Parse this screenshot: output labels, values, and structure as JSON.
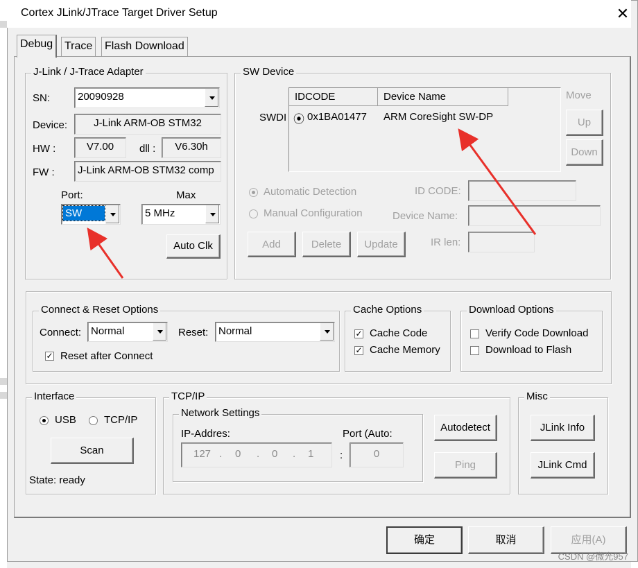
{
  "window": {
    "title": "Cortex JLink/JTrace Target Driver Setup",
    "close_glyph": "✕"
  },
  "tabs": [
    {
      "label": "Debug",
      "active": true
    },
    {
      "label": "Trace",
      "active": false
    },
    {
      "label": "Flash Download",
      "active": false
    }
  ],
  "adapter": {
    "group_label": "J-Link / J-Trace Adapter",
    "sn_label": "SN:",
    "sn_value": "20090928",
    "device_label": "Device:",
    "device_value": "J-Link ARM-OB STM32",
    "hw_label": "HW :",
    "hw_value": "V7.00",
    "dll_label": "dll :",
    "dll_value": "V6.30h",
    "fw_label": "FW :",
    "fw_value": "J-Link ARM-OB STM32 comp",
    "port_label": "Port:",
    "port_value": "SW",
    "max_label": "Max",
    "max_value": "5 MHz",
    "auto_clk_button": "Auto Clk"
  },
  "sw_device": {
    "group_label": "SW Device",
    "swdi_label": "SWDI",
    "columns": [
      "IDCODE",
      "Device Name"
    ],
    "rows": [
      {
        "radio": "⦿",
        "idcode": "0x1BA01477",
        "device_name": "ARM CoreSight SW-DP"
      }
    ],
    "move_label": "Move",
    "up_button": "Up",
    "down_button": "Down",
    "auto_detection_label": "Automatic Detection",
    "manual_config_label": "Manual Configuration",
    "id_code_label": "ID CODE:",
    "device_name_label": "Device Name:",
    "ir_len_label": "IR len:",
    "add_button": "Add",
    "delete_button": "Delete",
    "update_button": "Update"
  },
  "connect_reset": {
    "group_label": "Connect & Reset Options",
    "connect_label": "Connect:",
    "connect_value": "Normal",
    "reset_label": "Reset:",
    "reset_value": "Normal",
    "reset_after_connect_label": "Reset after Connect",
    "reset_after_connect_checked": true
  },
  "cache_options": {
    "group_label": "Cache Options",
    "cache_code_label": "Cache Code",
    "cache_code_checked": true,
    "cache_memory_label": "Cache Memory",
    "cache_memory_checked": true
  },
  "download_options": {
    "group_label": "Download Options",
    "verify_label": "Verify Code Download",
    "verify_checked": false,
    "download_flash_label": "Download to Flash",
    "download_flash_checked": false
  },
  "interface": {
    "group_label": "Interface",
    "usb_label": "USB",
    "tcpip_label": "TCP/IP",
    "scan_button": "Scan",
    "state_label": "State: ready"
  },
  "tcpip": {
    "group_label": "TCP/IP",
    "network_settings_label": "Network Settings",
    "ip_address_label": "IP-Addres:",
    "ip_octets": [
      "127",
      "0",
      "0",
      "1"
    ],
    "port_label": "Port (Auto:",
    "port_value": "0",
    "autodetect_button": "Autodetect",
    "ping_button": "Ping"
  },
  "misc": {
    "group_label": "Misc",
    "jlink_info_button": "JLink Info",
    "jlink_cmd_button": "JLink Cmd"
  },
  "footer": {
    "ok_button": "确定",
    "cancel_button": "取消",
    "apply_button": "应用(A)"
  },
  "watermark": "CSDN @微光957",
  "colors": {
    "annotation_arrow": "#e8302a",
    "selection": "#0078d7"
  }
}
